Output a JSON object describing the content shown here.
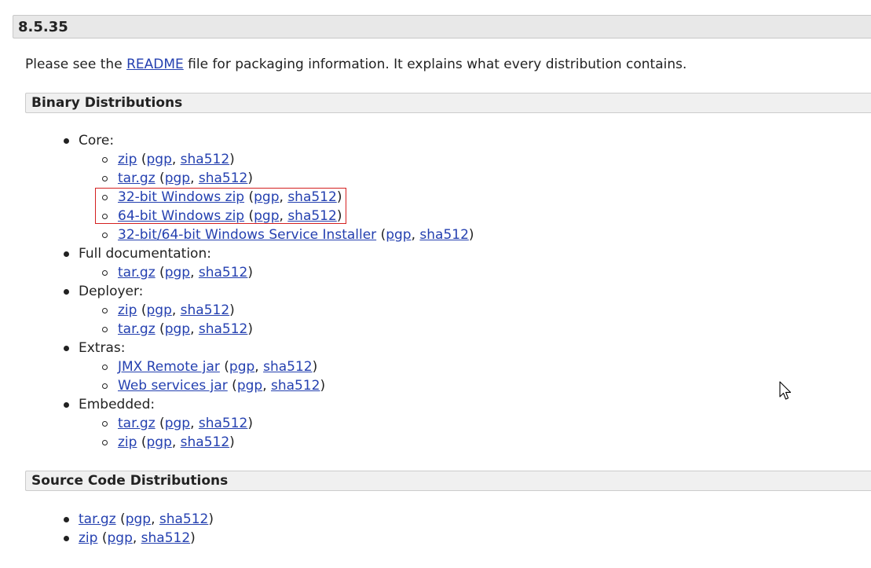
{
  "version": "8.5.35",
  "intro": {
    "before": "Please see the ",
    "link": "README",
    "after": " file for packaging information. It explains what every distribution contains."
  },
  "binary": {
    "heading": "Binary Distributions",
    "groups": [
      {
        "label": "Core:",
        "items": [
          {
            "link": "zip",
            "pgp": "pgp",
            "sha": "sha512"
          },
          {
            "link": "tar.gz",
            "pgp": "pgp",
            "sha": "sha512"
          },
          {
            "link": "32-bit Windows zip",
            "pgp": "pgp",
            "sha": "sha512"
          },
          {
            "link": "64-bit Windows zip",
            "pgp": "pgp",
            "sha": "sha512"
          },
          {
            "link": "32-bit/64-bit Windows Service Installer",
            "pgp": "pgp",
            "sha": "sha512"
          }
        ]
      },
      {
        "label": "Full documentation:",
        "items": [
          {
            "link": "tar.gz",
            "pgp": "pgp",
            "sha": "sha512"
          }
        ]
      },
      {
        "label": "Deployer:",
        "items": [
          {
            "link": "zip",
            "pgp": "pgp",
            "sha": "sha512"
          },
          {
            "link": "tar.gz",
            "pgp": "pgp",
            "sha": "sha512"
          }
        ]
      },
      {
        "label": "Extras:",
        "items": [
          {
            "link": "JMX Remote jar",
            "pgp": "pgp",
            "sha": "sha512"
          },
          {
            "link": "Web services jar",
            "pgp": "pgp",
            "sha": "sha512"
          }
        ]
      },
      {
        "label": "Embedded:",
        "items": [
          {
            "link": "tar.gz",
            "pgp": "pgp",
            "sha": "sha512"
          },
          {
            "link": "zip",
            "pgp": "pgp",
            "sha": "sha512"
          }
        ]
      }
    ]
  },
  "source": {
    "heading": "Source Code Distributions",
    "items": [
      {
        "link": "tar.gz",
        "pgp": "pgp",
        "sha": "sha512"
      },
      {
        "link": "zip",
        "pgp": "pgp",
        "sha": "sha512"
      }
    ]
  },
  "punct": {
    "open": " (",
    "comma": ", ",
    "close": ")"
  },
  "colors": {
    "link": "#2440b0",
    "highlight": "#d42020",
    "header_bg": "#e8e8e8"
  },
  "icons": {
    "cursor": "mouse-pointer-icon"
  }
}
